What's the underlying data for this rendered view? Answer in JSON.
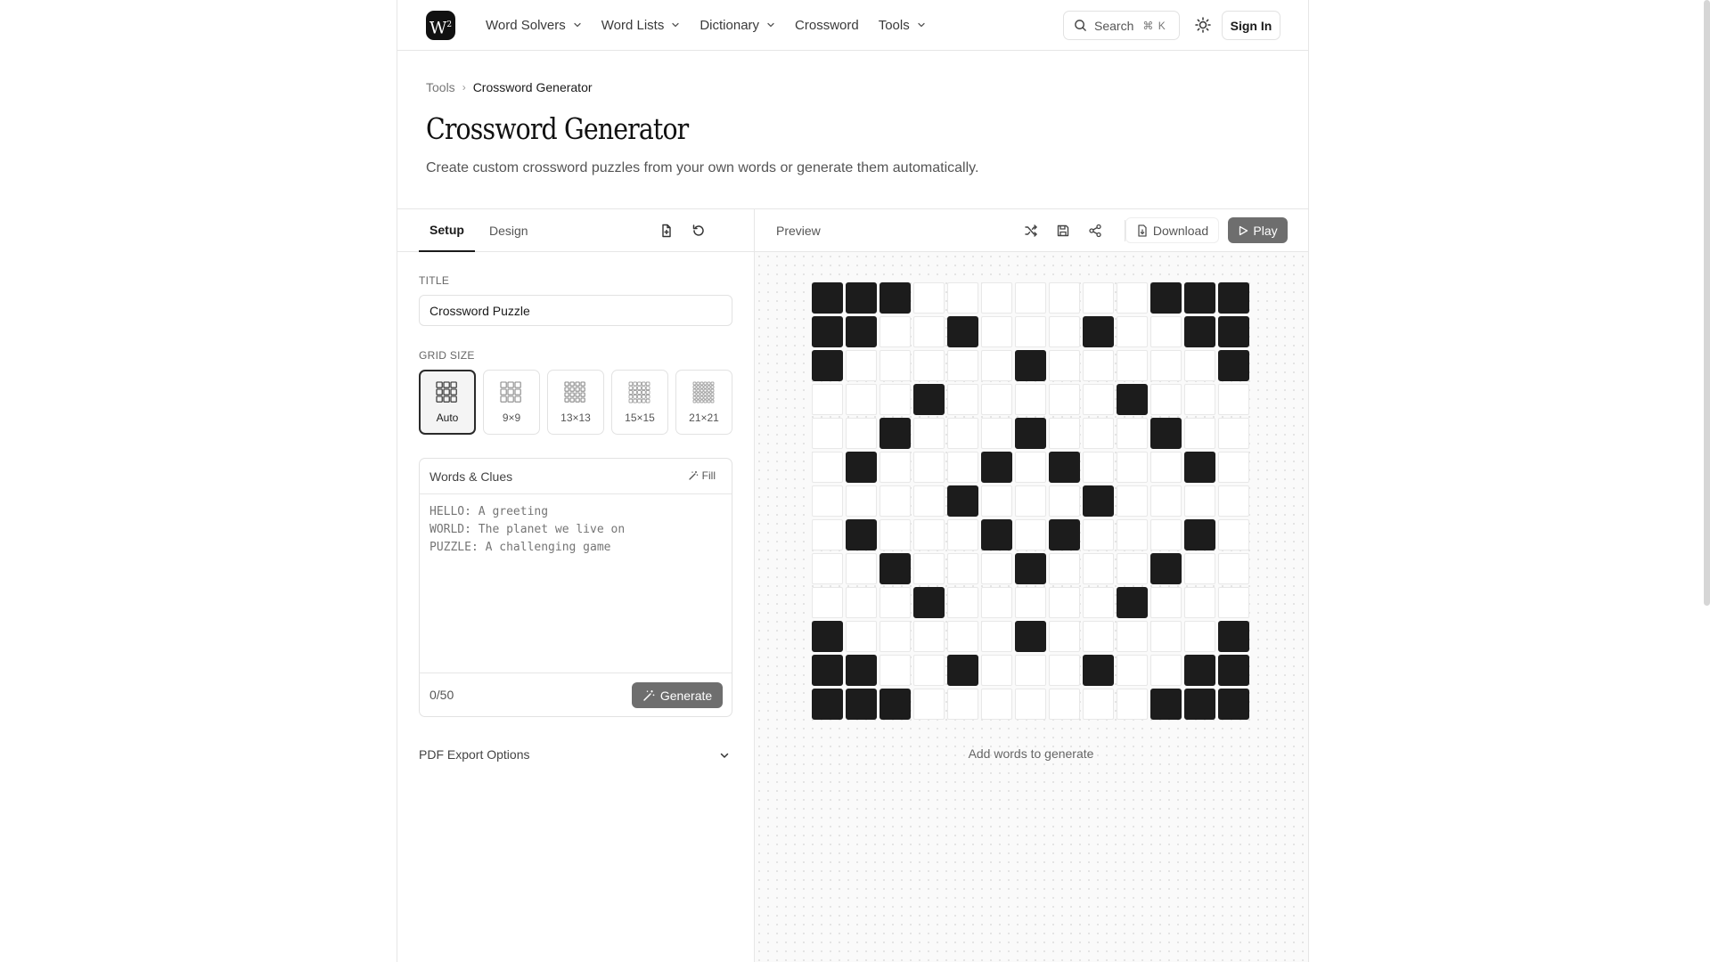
{
  "header": {
    "logo_text": "W",
    "logo_sup": "2",
    "nav": [
      {
        "label": "Word Solvers",
        "dropdown": true
      },
      {
        "label": "Word Lists",
        "dropdown": true
      },
      {
        "label": "Dictionary",
        "dropdown": true
      },
      {
        "label": "Crossword",
        "dropdown": false
      },
      {
        "label": "Tools",
        "dropdown": true
      }
    ],
    "search_label": "Search",
    "search_shortcut": "⌘ K",
    "signin_label": "Sign In"
  },
  "breadcrumb": {
    "parent": "Tools",
    "current": "Crossword Generator"
  },
  "page": {
    "title": "Crossword Generator",
    "description": "Create custom crossword puzzles from your own words or generate them automatically."
  },
  "setup": {
    "tabs": [
      {
        "label": "Setup",
        "active": true
      },
      {
        "label": "Design",
        "active": false
      }
    ],
    "title_label": "TITLE",
    "title_value": "Crossword Puzzle",
    "grid_size_label": "GRID SIZE",
    "grid_sizes": [
      {
        "label": "Auto",
        "selected": true
      },
      {
        "label": "9×9",
        "selected": false
      },
      {
        "label": "13×13",
        "selected": false
      },
      {
        "label": "15×15",
        "selected": false
      },
      {
        "label": "21×21",
        "selected": false
      }
    ],
    "words_title": "Words & Clues",
    "fill_label": "Fill",
    "words_placeholder": "HELLO: A greeting\nWORLD: The planet we live on\nPUZZLE: A challenging game",
    "word_count": "0/50",
    "generate_label": "Generate",
    "pdf_label": "PDF Export Options"
  },
  "preview": {
    "label": "Preview",
    "download_label": "Download",
    "play_label": "Play",
    "empty_message": "Add words to generate",
    "grid_pattern": [
      "###.......###",
      "##..#...#..##",
      "#.....#.....#",
      "...#.....#...",
      "..#...#...#..",
      ".#...#.#...#.",
      "....#...#....",
      ".#...#.#...#.",
      "..#...#...#..",
      "...#.....#...",
      "#.....#.....#",
      "##..#...#..##",
      "###.......###"
    ]
  },
  "colors": {
    "accent_dark": "#1c1c1c",
    "button_gray": "#6e6e6e",
    "border": "#e2e2e2"
  }
}
